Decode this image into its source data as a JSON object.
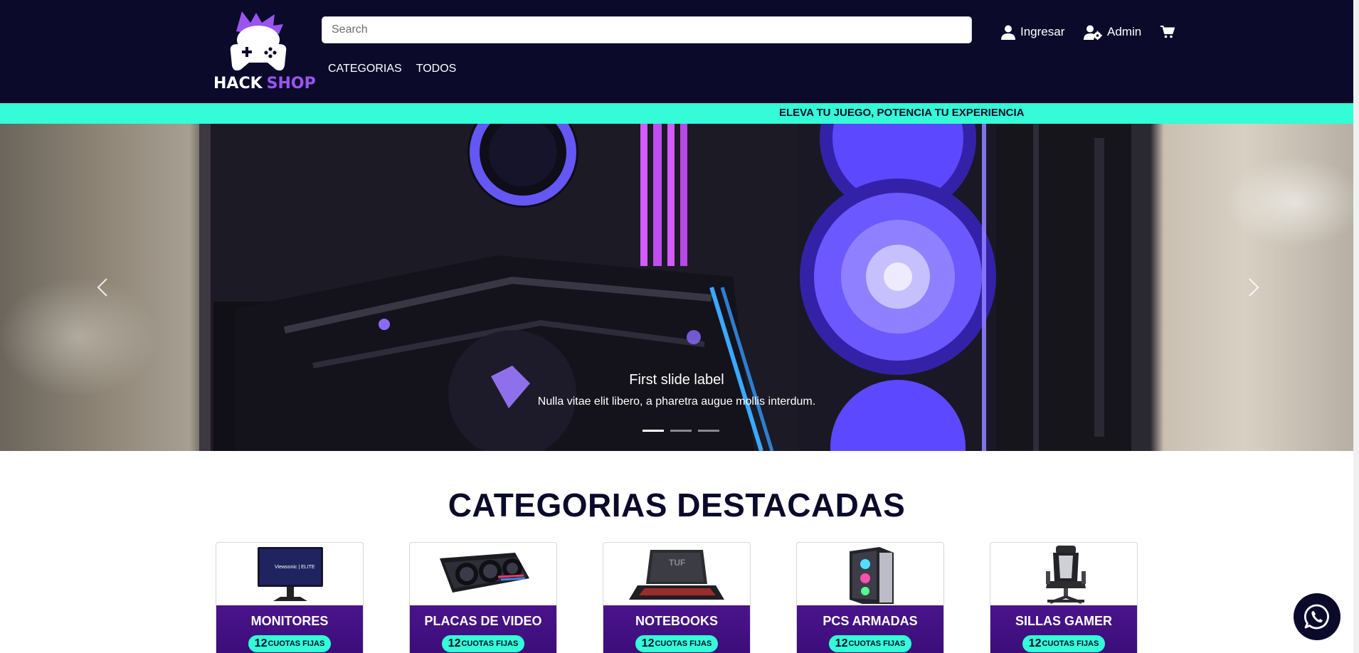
{
  "header": {
    "logo": {
      "word_light": "HACK",
      "word_accent": "SHOP"
    },
    "search": {
      "placeholder": "Search",
      "value": ""
    },
    "login_label": "Ingresar",
    "admin_label": "Admin",
    "nav": [
      "CATEGORIAS",
      "TODOS"
    ]
  },
  "announcement": {
    "text": "ELEVA TU JUEGO, POTENCIA TU EXPERIENCIA"
  },
  "carousel": {
    "slide_title": "First slide label",
    "slide_text": "Nulla vitae elit libero, a pharetra augue mollis interdum.",
    "slide_count": 3,
    "active_slide": 1
  },
  "featured": {
    "title": "CATEGORIAS DESTACADAS",
    "cards": [
      {
        "name": "MONITORES",
        "badge_number": "12",
        "badge_text": "CUOTAS FIJAS",
        "icon": "monitor-image"
      },
      {
        "name": "PLACAS DE VIDEO",
        "badge_number": "12",
        "badge_text": "CUOTAS FIJAS",
        "icon": "graphics-card-image"
      },
      {
        "name": "NOTEBOOKS",
        "badge_number": "12",
        "badge_text": "CUOTAS FIJAS",
        "icon": "notebook-image"
      },
      {
        "name": "PCS ARMADAS",
        "badge_number": "12",
        "badge_text": "CUOTAS FIJAS",
        "icon": "pc-case-image"
      },
      {
        "name": "SILLAS GAMER",
        "badge_number": "12",
        "badge_text": "CUOTAS FIJAS",
        "icon": "gaming-chair-image"
      }
    ]
  },
  "colors": {
    "header_bg": "#0b0a2b",
    "accent_cyan": "#33fcd6",
    "accent_purple": "#9a55f0",
    "card_band": "#4a148c"
  },
  "icons": {
    "login": "user-icon",
    "admin": "user-gear-icon",
    "cart": "cart-icon",
    "prev": "chevron-left-icon",
    "next": "chevron-right-icon",
    "whatsapp": "whatsapp-icon"
  }
}
